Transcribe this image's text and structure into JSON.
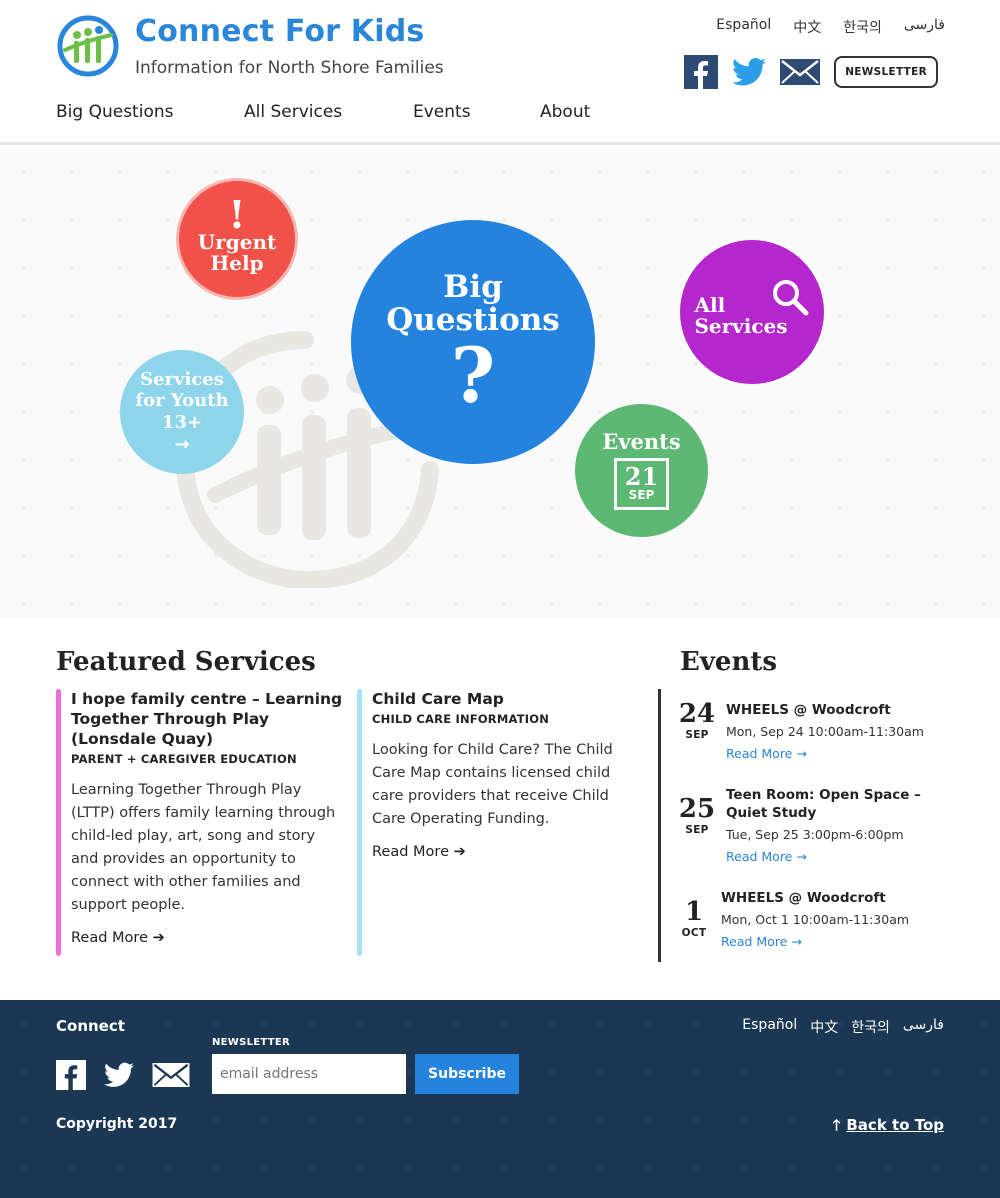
{
  "header": {
    "title": "Connect For Kids",
    "tagline": "Information for North Shore Families",
    "languages": [
      "Español",
      "中文",
      "한국의",
      "فارسی"
    ],
    "social": [
      "facebook-icon",
      "twitter-icon",
      "mail-icon"
    ],
    "newsletter_label": "NEWSLETTER",
    "nav": [
      "Big Questions",
      "All Services",
      "Events",
      "About"
    ]
  },
  "hero": {
    "urgent": {
      "line1": "Urgent",
      "line2": "Help",
      "symbol": "!"
    },
    "big": {
      "line1": "Big",
      "line2": "Questions",
      "symbol": "?"
    },
    "all": {
      "line1": "All",
      "line2": "Services"
    },
    "youth": {
      "line1": "Services",
      "line2": "for Youth",
      "line3": "13+",
      "arrow": "→"
    },
    "events": {
      "label": "Events",
      "day": "21",
      "month": "SEP"
    }
  },
  "featured": {
    "title": "Featured Services",
    "items": [
      {
        "title": "I hope family centre – Learning Together Through Play (Lonsdale Quay)",
        "category": "PARENT + CAREGIVER EDUCATION",
        "description": "Learning Together Through Play (LTTP) offers family learning through child-led play, art, song and story and provides an opportunity to connect with other families and support people.",
        "more": "Read More ➔"
      },
      {
        "title": "Child Care Map",
        "category": "CHILD CARE INFORMATION",
        "description": "Looking for Child Care? The Child Care Map contains licensed child care providers that receive Child Care Operating Funding.",
        "more": "Read More ➔"
      }
    ]
  },
  "events": {
    "title": "Events",
    "items": [
      {
        "day": "24",
        "month": "SEP",
        "title": "WHEELS @ Woodcroft",
        "time": "Mon, Sep 24 10:00am-11:30am",
        "more": "Read More →"
      },
      {
        "day": "25",
        "month": "SEP",
        "title": "Teen Room: Open Space – Quiet Study",
        "time": "Tue, Sep 25 3:00pm-6:00pm",
        "more": "Read More →"
      },
      {
        "day": "1",
        "month": "OCT",
        "title": "WHEELS @ Woodcroft",
        "time": "Mon, Oct 1 10:00am-11:30am",
        "more": "Read More →"
      }
    ]
  },
  "footer": {
    "connect": "Connect",
    "newsletter_label": "NEWSLETTER",
    "email_placeholder": "email address",
    "subscribe": "Subscribe",
    "copyright": "Copyright 2017",
    "languages": [
      "Español",
      "中文",
      "한국의",
      "فارسی"
    ],
    "back_to_top": "Back to Top",
    "back_arrow": "🡑"
  },
  "colors": {
    "brand_blue": "#2a86d8",
    "urgent_red": "#f05149",
    "big_blue": "#2383de",
    "all_purple": "#b327cc",
    "youth_cyan": "#8ed5eb",
    "events_green": "#5cb872",
    "featured_bar_1": "#f06ee0",
    "featured_bar_2": "#a5e2f5",
    "footer_navy": "#1c3753"
  }
}
